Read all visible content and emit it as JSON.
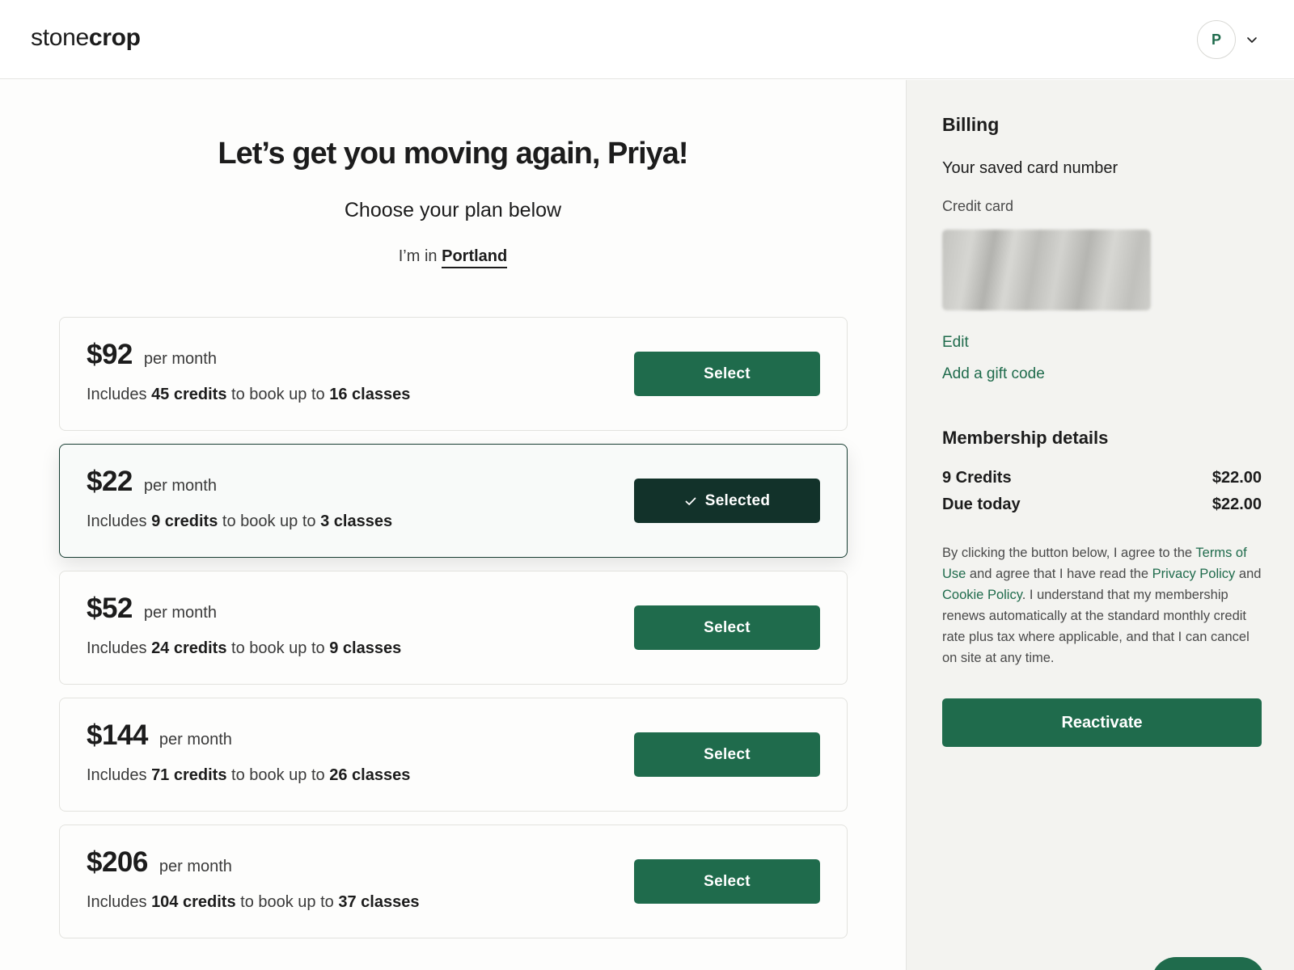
{
  "header": {
    "logo_light": "stone",
    "logo_bold": "crop",
    "avatar_initial": "P"
  },
  "main": {
    "headline": "Let’s get you moving again, Priya!",
    "subhead": "Choose your plan below",
    "location_prefix": "I’m in",
    "location_city": "Portland"
  },
  "plans": [
    {
      "price": "$92",
      "per": "per month",
      "includes": "Includes",
      "credits": "45 credits",
      "mid": "to book up to",
      "classes": "16 classes",
      "button": "Select",
      "selected": false
    },
    {
      "price": "$22",
      "per": "per month",
      "includes": "Includes",
      "credits": "9 credits",
      "mid": "to book up to",
      "classes": "3 classes",
      "button": "Selected",
      "selected": true
    },
    {
      "price": "$52",
      "per": "per month",
      "includes": "Includes",
      "credits": "24 credits",
      "mid": "to book up to",
      "classes": "9 classes",
      "button": "Select",
      "selected": false
    },
    {
      "price": "$144",
      "per": "per month",
      "includes": "Includes",
      "credits": "71 credits",
      "mid": "to book up to",
      "classes": "26 classes",
      "button": "Select",
      "selected": false
    },
    {
      "price": "$206",
      "per": "per month",
      "includes": "Includes",
      "credits": "104 credits",
      "mid": "to book up to",
      "classes": "37 classes",
      "button": "Select",
      "selected": false
    }
  ],
  "sidebar": {
    "title": "Billing",
    "saved_card": "Your saved card number",
    "credit_card_label": "Credit card",
    "edit": "Edit",
    "gift_code": "Add a gift code",
    "membership_title": "Membership details",
    "credits_label": "9 Credits",
    "credits_value": "$22.00",
    "due_label": "Due today",
    "due_value": "$22.00",
    "legal": {
      "t1": "By clicking the button below, I agree to the ",
      "terms": "Terms of Use",
      "t2": " and agree that I have read the ",
      "privacy": "Privacy Policy",
      "t3": " and ",
      "cookie": "Cookie Policy",
      "t4": ". I understand that my membership renews automatically at the standard monthly credit rate plus tax where applicable, and that I can cancel on site at any time."
    },
    "reactivate": "Reactivate"
  },
  "colors": {
    "accent": "#1f6b4c",
    "selected_button": "#12322a",
    "sidebar_bg": "#f3f3f0"
  },
  "icons": {
    "avatar_chevron": "chevron-down-icon",
    "selected_check": "check-icon"
  }
}
